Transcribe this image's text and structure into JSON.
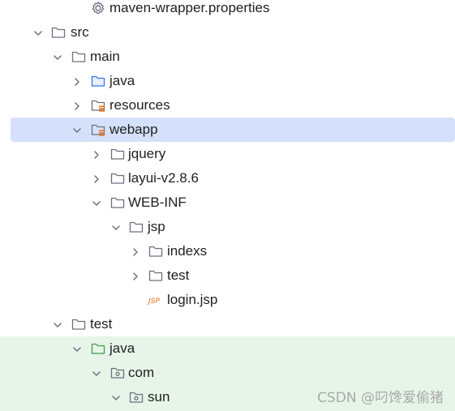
{
  "tree": {
    "items": [
      {
        "label": "maven-wrapper.properties",
        "icon": "gear-file-icon",
        "chevron": "none"
      },
      {
        "label": "src",
        "icon": "folder-icon",
        "chevron": "expanded"
      },
      {
        "label": "main",
        "icon": "folder-icon",
        "chevron": "expanded"
      },
      {
        "label": "java",
        "icon": "source-folder-icon",
        "chevron": "collapsed"
      },
      {
        "label": "resources",
        "icon": "resources-folder-icon",
        "chevron": "collapsed"
      },
      {
        "label": "webapp",
        "icon": "resources-folder-icon",
        "chevron": "expanded",
        "selected": true
      },
      {
        "label": "jquery",
        "icon": "folder-icon",
        "chevron": "collapsed"
      },
      {
        "label": "layui-v2.8.6",
        "icon": "folder-icon",
        "chevron": "collapsed"
      },
      {
        "label": "WEB-INF",
        "icon": "folder-icon",
        "chevron": "expanded"
      },
      {
        "label": "jsp",
        "icon": "folder-icon",
        "chevron": "expanded"
      },
      {
        "label": "indexs",
        "icon": "folder-icon",
        "chevron": "collapsed"
      },
      {
        "label": "test",
        "icon": "folder-icon",
        "chevron": "collapsed"
      },
      {
        "label": "login.jsp",
        "icon": "jsp-file-icon",
        "chevron": "none",
        "icon_text": "JSP"
      },
      {
        "label": "test",
        "icon": "folder-icon",
        "chevron": "expanded"
      },
      {
        "label": "java",
        "icon": "test-source-folder-icon",
        "chevron": "expanded"
      },
      {
        "label": "com",
        "icon": "package-icon",
        "chevron": "expanded"
      },
      {
        "label": "sun",
        "icon": "package-icon",
        "chevron": "expanded"
      }
    ]
  },
  "watermark": "CSDN @叼馋爱偷猪",
  "colors": {
    "selection": "#d5e1fb",
    "test_background": "#e6f5e8",
    "folder_stroke": "#6c707e",
    "source_folder": "#3574f0",
    "test_folder": "#3d9a50",
    "resources_mark": "#e66d17",
    "jsp_text": "#e66d17"
  }
}
